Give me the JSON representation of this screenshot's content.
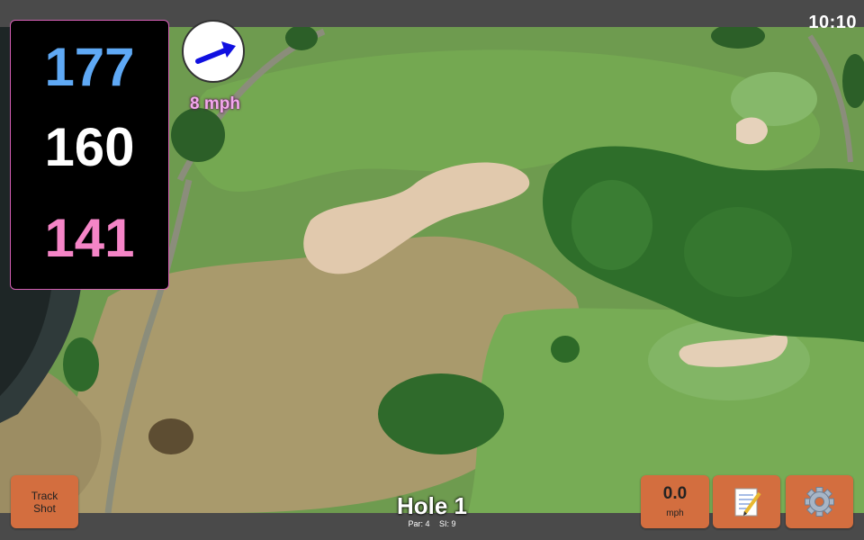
{
  "status": {
    "time": "10:10"
  },
  "distances": {
    "back": "177",
    "center": "160",
    "front": "141"
  },
  "wind": {
    "speed": "8 mph",
    "icon": "wind-direction-arrow-icon",
    "arrow_color": "#1010e0"
  },
  "buttons": {
    "track_shot": {
      "line1": "Track",
      "line2": "Shot"
    },
    "speed": {
      "value": "0.0",
      "unit": "mph"
    },
    "notes": {
      "icon": "notepad-icon"
    },
    "settings": {
      "icon": "gear-icon"
    }
  },
  "hole": {
    "title": "Hole 1",
    "par": "Par: 4",
    "si": "SI: 9"
  },
  "colors": {
    "back_distance": "#5fa9f5",
    "center_distance": "#ffffff",
    "front_distance": "#f585c7",
    "button": "#d36e3f",
    "wind_text": "#f2a7ec"
  }
}
